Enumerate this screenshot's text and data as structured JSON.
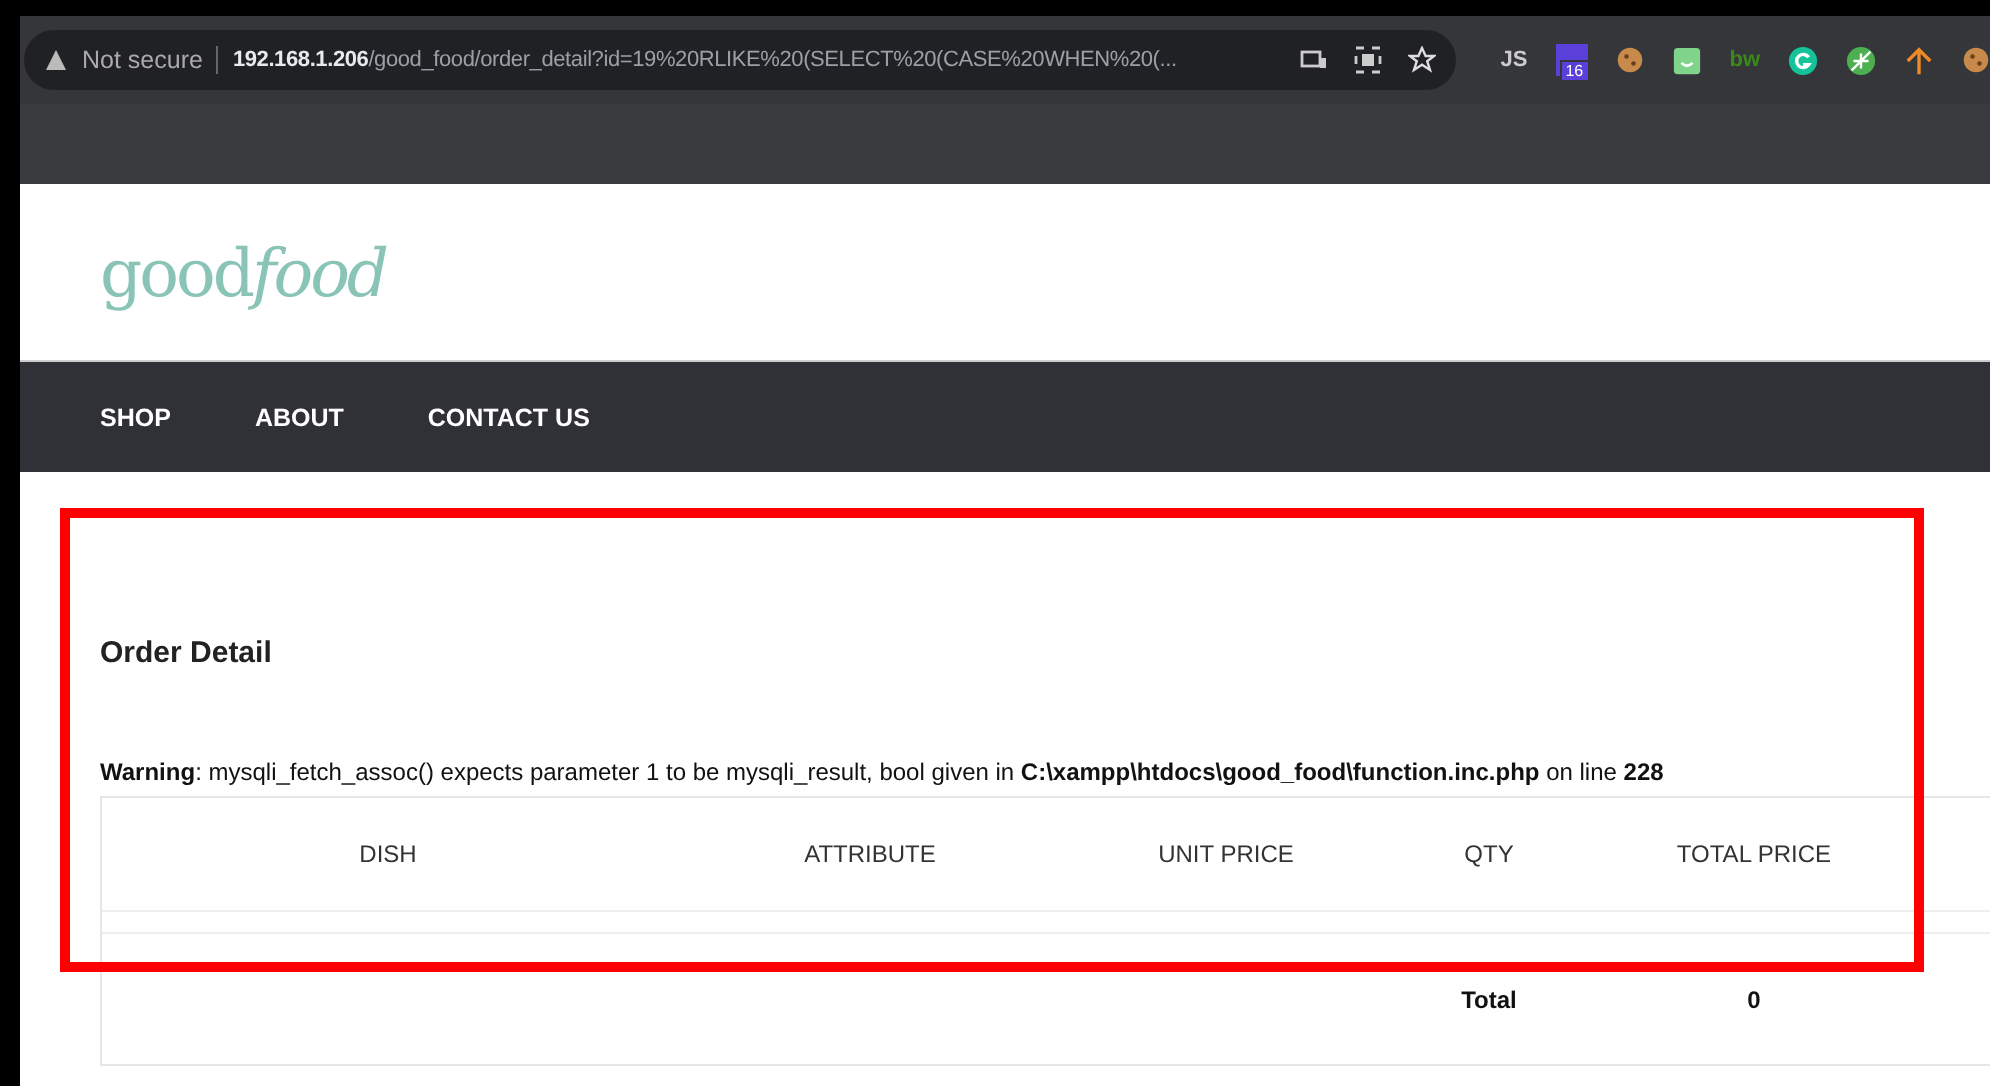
{
  "browser": {
    "security": "Not secure",
    "address": {
      "host": "192.168.1.206",
      "path": "/good_food/order_detail?id=19%20RLIKE%20(SELECT%20(CASE%20WHEN%20(..."
    },
    "extensions": [
      {
        "kind": "text",
        "label": "JS"
      },
      {
        "kind": "badge",
        "label": "16"
      },
      {
        "kind": "cookie"
      },
      {
        "kind": "square"
      },
      {
        "kind": "text",
        "label": "bw"
      },
      {
        "kind": "circle"
      },
      {
        "kind": "leaf"
      },
      {
        "kind": "arrow"
      },
      {
        "kind": "cookie"
      }
    ]
  },
  "site": {
    "logo": {
      "plain": "good",
      "italic": "food"
    },
    "nav": [
      {
        "label": "SHOP"
      },
      {
        "label": "ABOUT"
      },
      {
        "label": "CONTACT US"
      }
    ],
    "title": "Order Detail",
    "warning": "**Warning**: mysqli_fetch_assoc() expects parameter 1 to be mysqli_result, bool given in **C:\\xampp\\htdocs\\good_food\\function.inc.php** on line **228**",
    "table": {
      "columns": [
        "DISH",
        "ATTRIBUTE",
        "UNIT PRICE",
        "QTY",
        "TOTAL PRICE"
      ],
      "total_label": "Total",
      "total_value": "0"
    }
  },
  "annotation": {
    "kind": "highlight-box",
    "color": "#ff0000"
  }
}
